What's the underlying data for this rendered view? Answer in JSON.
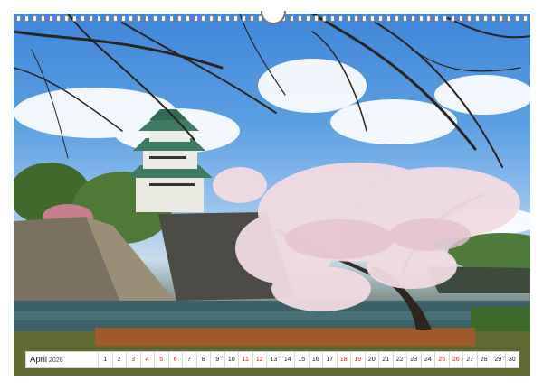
{
  "calendar": {
    "month": "April",
    "year": "2026",
    "days": [
      {
        "n": "1",
        "red": false
      },
      {
        "n": "2",
        "red": false
      },
      {
        "n": "3",
        "red": true
      },
      {
        "n": "4",
        "red": true
      },
      {
        "n": "5",
        "red": true
      },
      {
        "n": "6",
        "red": true
      },
      {
        "n": "7",
        "red": false
      },
      {
        "n": "8",
        "red": false
      },
      {
        "n": "9",
        "red": false
      },
      {
        "n": "10",
        "red": false
      },
      {
        "n": "11",
        "red": true
      },
      {
        "n": "12",
        "red": true
      },
      {
        "n": "13",
        "red": false
      },
      {
        "n": "14",
        "red": false
      },
      {
        "n": "15",
        "red": false
      },
      {
        "n": "16",
        "red": false
      },
      {
        "n": "17",
        "red": false
      },
      {
        "n": "18",
        "red": true
      },
      {
        "n": "19",
        "red": true
      },
      {
        "n": "20",
        "red": false
      },
      {
        "n": "21",
        "red": false
      },
      {
        "n": "22",
        "red": false
      },
      {
        "n": "23",
        "red": false
      },
      {
        "n": "24",
        "red": false
      },
      {
        "n": "25",
        "red": true
      },
      {
        "n": "26",
        "red": true
      },
      {
        "n": "27",
        "red": false
      },
      {
        "n": "28",
        "red": false
      },
      {
        "n": "29",
        "red": false
      },
      {
        "n": "30",
        "red": false
      }
    ]
  },
  "colors": {
    "sky": "#4a90dd",
    "blossom": "#f2dbe2",
    "holiday_red": "#d0202a"
  }
}
